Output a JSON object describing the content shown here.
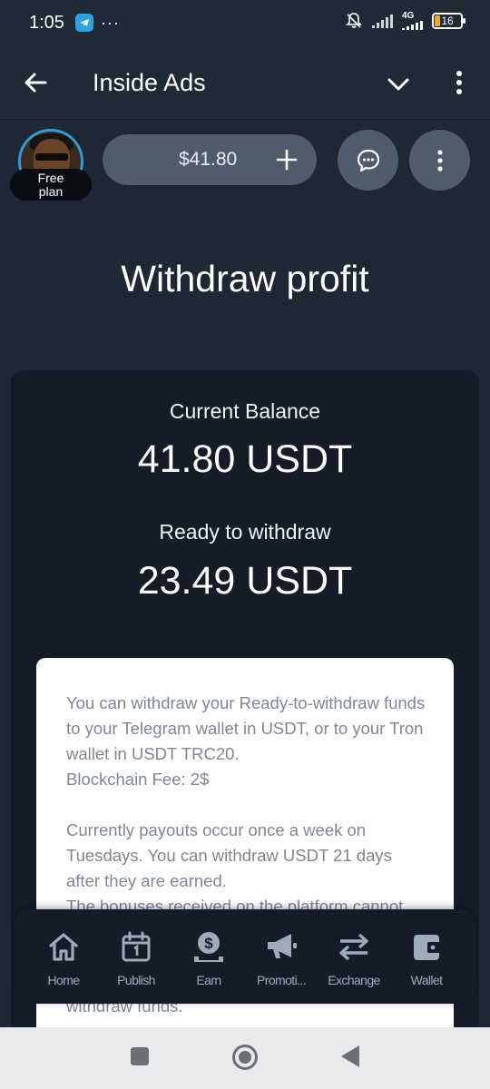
{
  "status_bar": {
    "time": "1:05",
    "network": "4G",
    "battery": "16",
    "overflow": "···"
  },
  "app_bar": {
    "title": "Inside Ads"
  },
  "profile": {
    "plan_line1": "Free",
    "plan_line2": "plan"
  },
  "balance_pill": {
    "amount": "$41.80"
  },
  "page": {
    "title": "Withdraw profit"
  },
  "balances": {
    "current_label": "Current Balance",
    "current_value": "41.80 USDT",
    "ready_label": "Ready to withdraw",
    "ready_value": "23.49 USDT"
  },
  "info": {
    "p1": "You can withdraw your Ready-to-withdraw funds to your Telegram wallet in USDT, or to your Tron wallet in USDT TRC20.",
    "p1_fee": "Blockchain Fee: 2$",
    "p2": "Currently payouts occur once a week on Tuesdays. You can withdraw USDT 21 days after they are earned.",
    "p3": "The bonuses received on the platform cannot",
    "p3_end": "withdraw funds."
  },
  "bottom_nav": {
    "items": [
      {
        "label": "Home",
        "icon": "home-icon"
      },
      {
        "label": "Publish",
        "icon": "calendar-icon"
      },
      {
        "label": "Earn",
        "icon": "money-bag-icon"
      },
      {
        "label": "Promoti...",
        "icon": "megaphone-icon"
      },
      {
        "label": "Exchange",
        "icon": "exchange-arrows-icon"
      },
      {
        "label": "Wallet",
        "icon": "wallet-icon"
      }
    ]
  },
  "colors": {
    "background": "#1e2733",
    "card": "#151c28",
    "pill": "#4e5c6e",
    "accent": "#2f9ed8",
    "info_text": "#7f8790",
    "nav_icon": "#9eacba"
  }
}
